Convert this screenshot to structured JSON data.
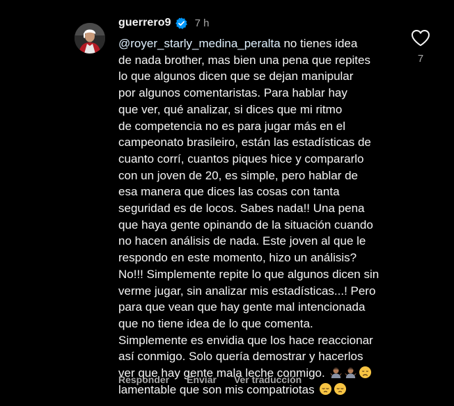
{
  "comment": {
    "username": "guerrero9",
    "verified_icon": "verified-badge-icon",
    "timestamp": "7 h",
    "mention": "@royer_starly_medina_peralta",
    "lines": [
      " no tienes idea",
      "de nada brother, mas bien una pena que repites",
      "lo que algunos dicen que se dejan manipular",
      "por algunos comentaristas. Para hablar hay",
      "que ver, qué analizar, si dices que mi ritmo",
      "de competencia no es para jugar más en el",
      "campeonato brasileiro, están las estadísticas de",
      "cuanto corrí, cuantos piques hice y compararlo",
      "con un joven de 20, es simple, pero hablar de",
      "esa manera que dices las cosas con tanta",
      "seguridad es de locos. Sabes nada!! Una pena",
      "que haya gente opinando de la situación cuando",
      "no hacen análisis de nada. Este joven al que le",
      "respondo en este momento, hizo un análisis?",
      "No!!! Simplemente repite lo que algunos dicen sin",
      "verme jugar, sin analizar mis estadísticas...! Pero",
      "para que vean que hay gente mal intencionada",
      "que no tiene idea de lo que comenta.",
      "Simplemente es envidia que los hace reaccionar",
      "así conmigo. Solo quería demostrar y hacerlos",
      "ver que hay gente mala leche conmigo. ",
      "lamentable que son mis compatriotas "
    ],
    "emojis_line_21": [
      "person-shrugging-emoji",
      "person-shrugging-emoji",
      "disappointed-face-emoji"
    ],
    "emojis_line_22": [
      "pensive-face-emoji",
      "pensive-face-emoji"
    ]
  },
  "actions": {
    "reply": "Responder",
    "send": "Enviar",
    "translate": "Ver traducción"
  },
  "like": {
    "icon": "heart-outline-icon",
    "count": "7"
  },
  "colors": {
    "background": "#000000",
    "text": "#f5f5f5",
    "secondary": "#a8a8a8",
    "verified": "#0095f6"
  }
}
